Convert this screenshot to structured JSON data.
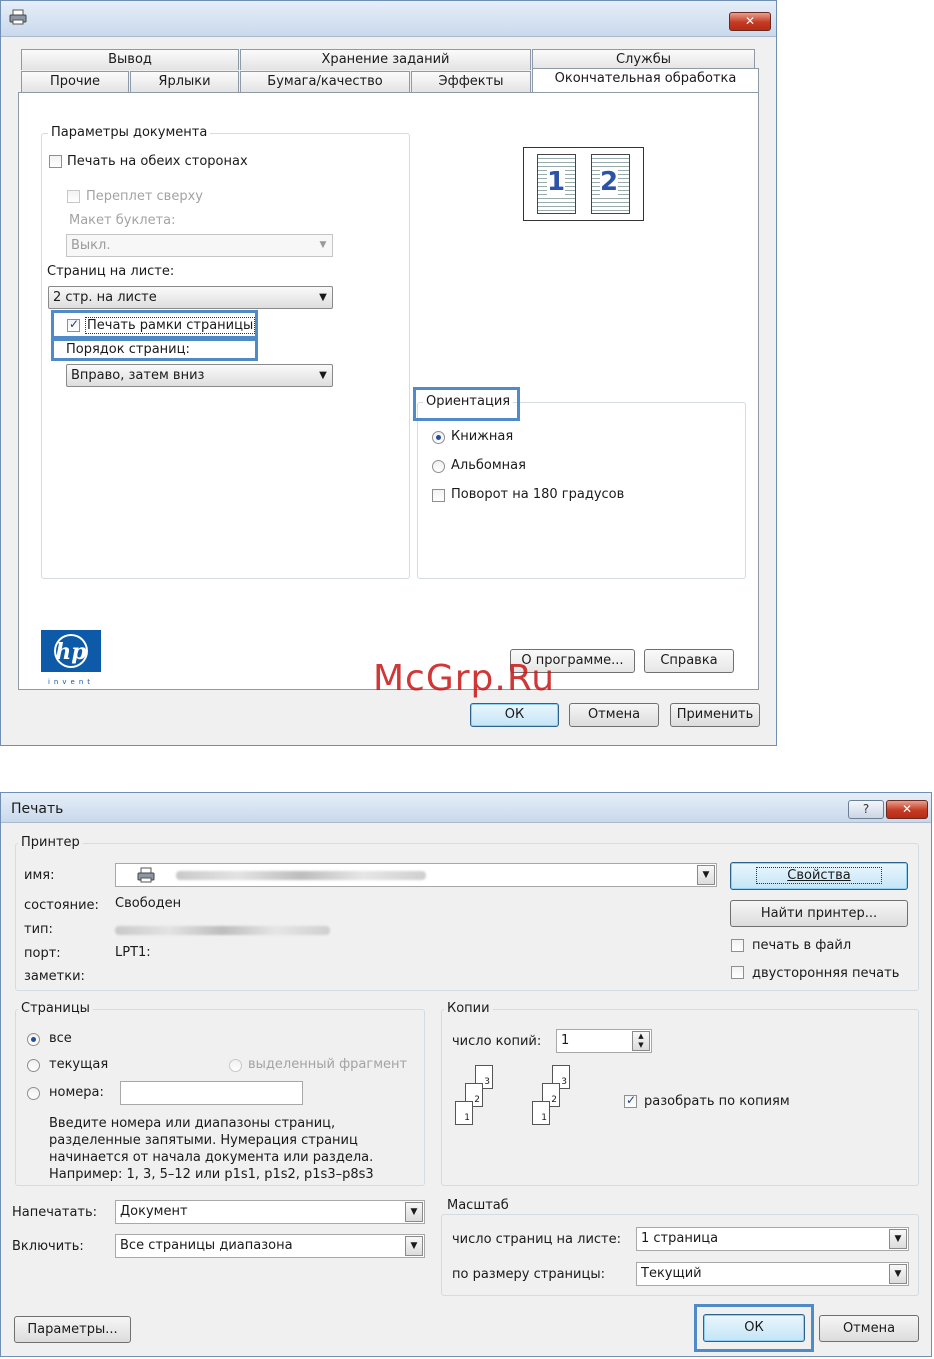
{
  "dialog1": {
    "icon": "printer-icon",
    "tabs_row1": [
      "Вывод",
      "Хранение заданий",
      "Службы"
    ],
    "tabs_row2": [
      "Прочие",
      "Ярлыки",
      "Бумага/качество",
      "Эффекты",
      "Окончательная обработка"
    ],
    "active_tab": "Окончательная обработка",
    "doc_params": {
      "legend": "Параметры документа",
      "duplex_label": "Печать на обеих сторонах",
      "binding_label": "Переплет сверху",
      "booklet_label": "Макет буклета:",
      "booklet_value": "Выкл.",
      "pages_per_sheet_label": "Страниц на листе:",
      "pages_per_sheet_value": "2 стр. на листе",
      "print_borders_label": "Печать рамки страницы",
      "print_borders_checked": true,
      "page_order_label": "Порядок страниц:",
      "page_order_value": "Вправо, затем вниз"
    },
    "preview_numbers": [
      "1",
      "2"
    ],
    "orientation": {
      "legend": "Ориентация",
      "portrait_label": "Книжная",
      "landscape_label": "Альбомная",
      "rotate_label": "Поворот на 180 градусов",
      "selected": "Книжная"
    },
    "logo_text": "invent",
    "about_button": "О программе...",
    "help_button": "Справка",
    "ok_button": "ОК",
    "cancel_button": "Отмена",
    "apply_button": "Применить"
  },
  "watermark": "McGrp.Ru",
  "dialog2": {
    "title": "Печать",
    "help_glyph": "?",
    "printer": {
      "legend": "Принтер",
      "name_label": "имя:",
      "status_label": "состояние:",
      "status_value": "Свободен",
      "type_label": "тип:",
      "port_label": "порт:",
      "port_value": "LPT1:",
      "notes_label": "заметки:",
      "properties_button": "Свойства",
      "find_button": "Найти принтер...",
      "print_to_file_label": "печать в файл",
      "duplex_label": "двусторонняя печать"
    },
    "pages": {
      "legend": "Страницы",
      "all_label": "все",
      "current_label": "текущая",
      "selection_label": "выделенный фрагмент",
      "numbers_label": "номера:",
      "hint": [
        "Введите номера или диапазоны страниц,",
        "разделенные запятыми. Нумерация страниц",
        "начинается от начала документа или раздела.",
        "Например: 1, 3, 5–12 или p1s1, p1s2, p1s3–p8s3"
      ]
    },
    "copies": {
      "legend": "Копии",
      "count_label": "число копий:",
      "count_value": "1",
      "collate_label": "разобрать по копиям",
      "collate_checked": true,
      "page_icons": [
        "1",
        "2",
        "3"
      ]
    },
    "print_what_label": "Напечатать:",
    "print_what_value": "Документ",
    "include_label": "Включить:",
    "include_value": "Все страницы диапазона",
    "scale": {
      "legend": "Масштаб",
      "pages_per_sheet_label": "число страниц на листе:",
      "pages_per_sheet_value": "1 страница",
      "fit_label": "по размеру страницы:",
      "fit_value": "Текущий"
    },
    "options_button": "Параметры...",
    "ok_button": "ОК",
    "cancel_button": "Отмена"
  }
}
